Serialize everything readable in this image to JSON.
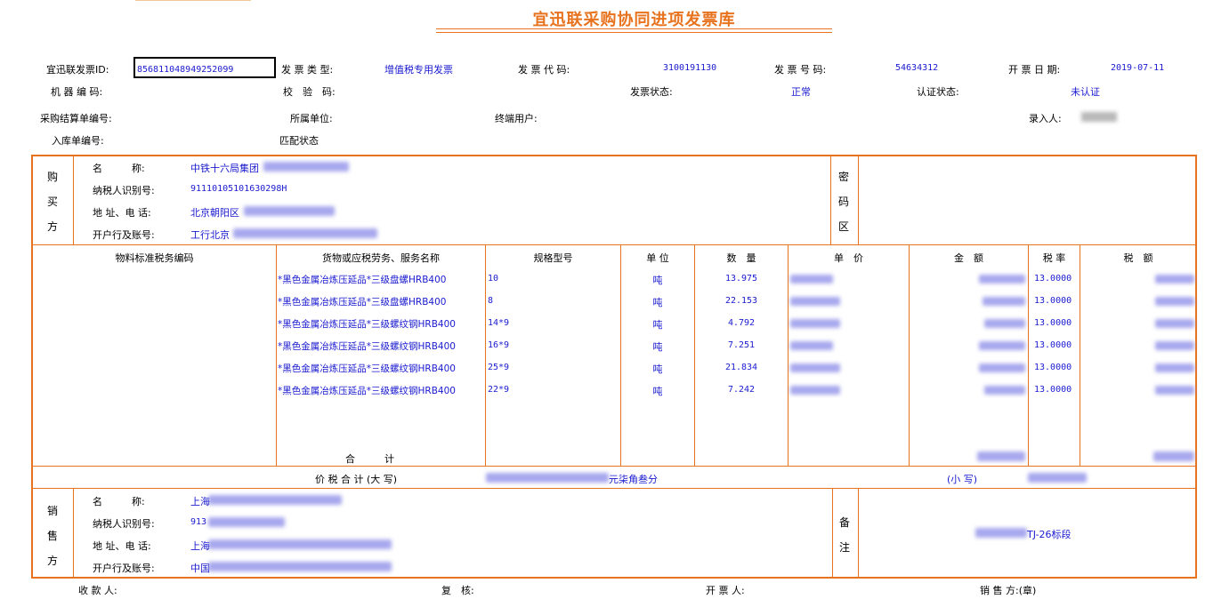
{
  "title": "宜迅联采购协同进项发票库",
  "header": {
    "id_label": "宜迅联发票ID:",
    "id_value": "856811048949252099",
    "type_label": "发 票 类 型:",
    "type_value": "增值税专用发票",
    "code_label": "发 票 代 码:",
    "code_value": "3100191130",
    "number_label": "发 票 号 码:",
    "number_value": "54634312",
    "date_label": "开 票 日 期:",
    "date_value": "2019-07-11",
    "machine_label": "机 器 编 码:",
    "check_label": "校　验　码:",
    "status_label": "发票状态:",
    "status_value": "正常",
    "auth_label": "认证状态:",
    "auth_value": "未认证",
    "settle_label": "采购结算单编号:",
    "unit_label": "所属单位:",
    "enduser_label": "终端用户:",
    "entry_label": "录入人:",
    "warehouse_label": "入库单编号:",
    "match_label": "匹配状态"
  },
  "buyer": {
    "side_chars": [
      "购",
      "买",
      "方"
    ],
    "name_label": "名　　　称:",
    "name_value": "中铁十六局集团",
    "tax_label": "纳税人识别号:",
    "tax_value": "91110105101630298H",
    "addr_label": "地 址、电 话:",
    "addr_value": "北京朝阳区",
    "bank_label": "开户行及账号:",
    "bank_value": "工行北京"
  },
  "cipher": {
    "chars": [
      "密",
      "码",
      "区"
    ]
  },
  "items": {
    "headers": {
      "material_code": "物料标准税务编码",
      "goods": "货物或应税劳务、服务名称",
      "spec": "规格型号",
      "unit": "单 位",
      "qty": "数　量",
      "price": "单　价",
      "amount": "金　额",
      "rate": "税 率",
      "tax": "税　额"
    },
    "rows": [
      {
        "goods": "*黑色金属冶炼压延品*三级盘螺HRB400",
        "spec": "10",
        "unit": "吨",
        "qty": "13.975",
        "rate": "13.0000"
      },
      {
        "goods": "*黑色金属冶炼压延品*三级盘螺HRB400",
        "spec": "8",
        "unit": "吨",
        "qty": "22.153",
        "rate": "13.0000"
      },
      {
        "goods": "*黑色金属冶炼压延品*三级螺纹钢HRB400",
        "spec": "14*9",
        "unit": "吨",
        "qty": "4.792",
        "rate": "13.0000"
      },
      {
        "goods": "*黑色金属冶炼压延品*三级螺纹钢HRB400",
        "spec": "16*9",
        "unit": "吨",
        "qty": "7.251",
        "rate": "13.0000"
      },
      {
        "goods": "*黑色金属冶炼压延品*三级螺纹钢HRB400",
        "spec": "25*9",
        "unit": "吨",
        "qty": "21.834",
        "rate": "13.0000"
      },
      {
        "goods": "*黑色金属冶炼压延品*三级螺纹钢HRB400",
        "spec": "22*9",
        "unit": "吨",
        "qty": "7.242",
        "rate": "13.0000"
      }
    ],
    "total_label": "合　　　计"
  },
  "totals": {
    "big_label": "价 税 合 计 (大 写)",
    "big_suffix": "元柒角叁分",
    "small_label": "(小 写)"
  },
  "seller": {
    "side_chars": [
      "销",
      "售",
      "方"
    ],
    "name_label": "名　　　称:",
    "name_value": "上海",
    "tax_label": "纳税人识别号:",
    "tax_value": "913",
    "addr_label": "地 址、电 话:",
    "addr_value": "上海",
    "bank_label": "开户行及账号:",
    "bank_value": "中国"
  },
  "remarks": {
    "chars": [
      "备",
      "注"
    ],
    "value": "TJ-26标段"
  },
  "footer": {
    "payee": "收 款 人:",
    "reviewer": "复　核:",
    "drawer": "开 票 人:",
    "seller": "销 售 方:(章)"
  },
  "colors": {
    "accent": "#e8731e",
    "value_blue": "#1a1ad0"
  }
}
